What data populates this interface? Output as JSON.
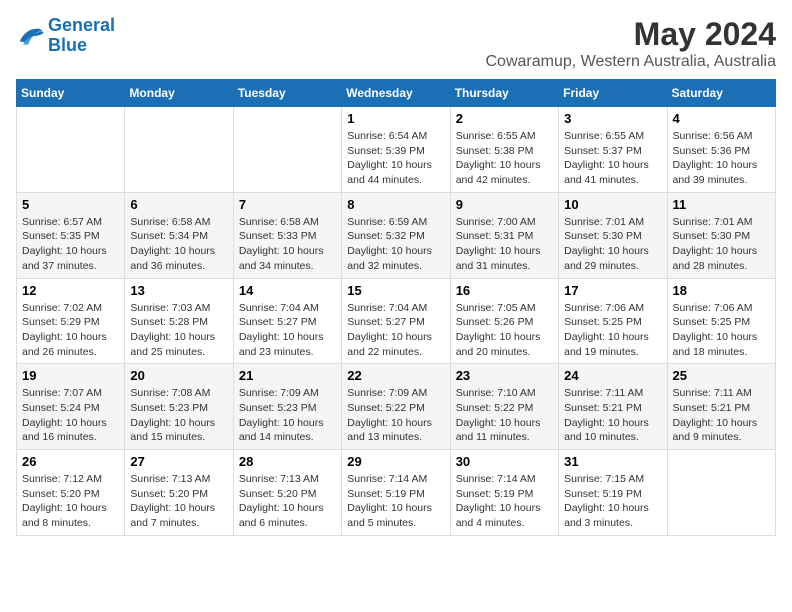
{
  "logo": {
    "line1": "General",
    "line2": "Blue"
  },
  "title": "May 2024",
  "subtitle": "Cowaramup, Western Australia, Australia",
  "days_of_week": [
    "Sunday",
    "Monday",
    "Tuesday",
    "Wednesday",
    "Thursday",
    "Friday",
    "Saturday"
  ],
  "weeks": [
    [
      {
        "day": "",
        "info": ""
      },
      {
        "day": "",
        "info": ""
      },
      {
        "day": "",
        "info": ""
      },
      {
        "day": "1",
        "info": "Sunrise: 6:54 AM\nSunset: 5:39 PM\nDaylight: 10 hours\nand 44 minutes."
      },
      {
        "day": "2",
        "info": "Sunrise: 6:55 AM\nSunset: 5:38 PM\nDaylight: 10 hours\nand 42 minutes."
      },
      {
        "day": "3",
        "info": "Sunrise: 6:55 AM\nSunset: 5:37 PM\nDaylight: 10 hours\nand 41 minutes."
      },
      {
        "day": "4",
        "info": "Sunrise: 6:56 AM\nSunset: 5:36 PM\nDaylight: 10 hours\nand 39 minutes."
      }
    ],
    [
      {
        "day": "5",
        "info": "Sunrise: 6:57 AM\nSunset: 5:35 PM\nDaylight: 10 hours\nand 37 minutes."
      },
      {
        "day": "6",
        "info": "Sunrise: 6:58 AM\nSunset: 5:34 PM\nDaylight: 10 hours\nand 36 minutes."
      },
      {
        "day": "7",
        "info": "Sunrise: 6:58 AM\nSunset: 5:33 PM\nDaylight: 10 hours\nand 34 minutes."
      },
      {
        "day": "8",
        "info": "Sunrise: 6:59 AM\nSunset: 5:32 PM\nDaylight: 10 hours\nand 32 minutes."
      },
      {
        "day": "9",
        "info": "Sunrise: 7:00 AM\nSunset: 5:31 PM\nDaylight: 10 hours\nand 31 minutes."
      },
      {
        "day": "10",
        "info": "Sunrise: 7:01 AM\nSunset: 5:30 PM\nDaylight: 10 hours\nand 29 minutes."
      },
      {
        "day": "11",
        "info": "Sunrise: 7:01 AM\nSunset: 5:30 PM\nDaylight: 10 hours\nand 28 minutes."
      }
    ],
    [
      {
        "day": "12",
        "info": "Sunrise: 7:02 AM\nSunset: 5:29 PM\nDaylight: 10 hours\nand 26 minutes."
      },
      {
        "day": "13",
        "info": "Sunrise: 7:03 AM\nSunset: 5:28 PM\nDaylight: 10 hours\nand 25 minutes."
      },
      {
        "day": "14",
        "info": "Sunrise: 7:04 AM\nSunset: 5:27 PM\nDaylight: 10 hours\nand 23 minutes."
      },
      {
        "day": "15",
        "info": "Sunrise: 7:04 AM\nSunset: 5:27 PM\nDaylight: 10 hours\nand 22 minutes."
      },
      {
        "day": "16",
        "info": "Sunrise: 7:05 AM\nSunset: 5:26 PM\nDaylight: 10 hours\nand 20 minutes."
      },
      {
        "day": "17",
        "info": "Sunrise: 7:06 AM\nSunset: 5:25 PM\nDaylight: 10 hours\nand 19 minutes."
      },
      {
        "day": "18",
        "info": "Sunrise: 7:06 AM\nSunset: 5:25 PM\nDaylight: 10 hours\nand 18 minutes."
      }
    ],
    [
      {
        "day": "19",
        "info": "Sunrise: 7:07 AM\nSunset: 5:24 PM\nDaylight: 10 hours\nand 16 minutes."
      },
      {
        "day": "20",
        "info": "Sunrise: 7:08 AM\nSunset: 5:23 PM\nDaylight: 10 hours\nand 15 minutes."
      },
      {
        "day": "21",
        "info": "Sunrise: 7:09 AM\nSunset: 5:23 PM\nDaylight: 10 hours\nand 14 minutes."
      },
      {
        "day": "22",
        "info": "Sunrise: 7:09 AM\nSunset: 5:22 PM\nDaylight: 10 hours\nand 13 minutes."
      },
      {
        "day": "23",
        "info": "Sunrise: 7:10 AM\nSunset: 5:22 PM\nDaylight: 10 hours\nand 11 minutes."
      },
      {
        "day": "24",
        "info": "Sunrise: 7:11 AM\nSunset: 5:21 PM\nDaylight: 10 hours\nand 10 minutes."
      },
      {
        "day": "25",
        "info": "Sunrise: 7:11 AM\nSunset: 5:21 PM\nDaylight: 10 hours\nand 9 minutes."
      }
    ],
    [
      {
        "day": "26",
        "info": "Sunrise: 7:12 AM\nSunset: 5:20 PM\nDaylight: 10 hours\nand 8 minutes."
      },
      {
        "day": "27",
        "info": "Sunrise: 7:13 AM\nSunset: 5:20 PM\nDaylight: 10 hours\nand 7 minutes."
      },
      {
        "day": "28",
        "info": "Sunrise: 7:13 AM\nSunset: 5:20 PM\nDaylight: 10 hours\nand 6 minutes."
      },
      {
        "day": "29",
        "info": "Sunrise: 7:14 AM\nSunset: 5:19 PM\nDaylight: 10 hours\nand 5 minutes."
      },
      {
        "day": "30",
        "info": "Sunrise: 7:14 AM\nSunset: 5:19 PM\nDaylight: 10 hours\nand 4 minutes."
      },
      {
        "day": "31",
        "info": "Sunrise: 7:15 AM\nSunset: 5:19 PM\nDaylight: 10 hours\nand 3 minutes."
      },
      {
        "day": "",
        "info": ""
      }
    ]
  ]
}
